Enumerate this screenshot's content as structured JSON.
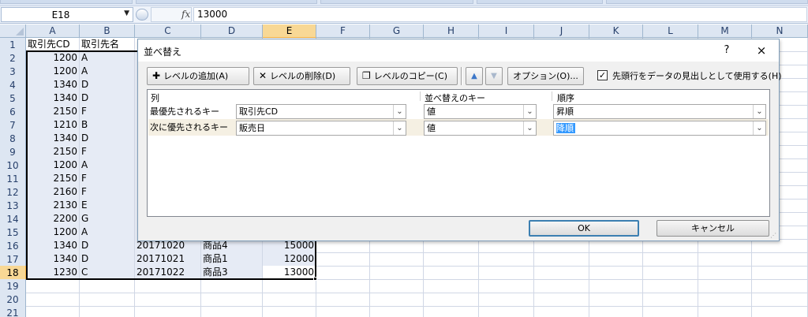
{
  "name_box": "E18",
  "fx_label": "fx",
  "formula_value": "13000",
  "columns": [
    "A",
    "B",
    "C",
    "D",
    "E",
    "F",
    "G",
    "H",
    "I",
    "J",
    "K",
    "L",
    "M",
    "N"
  ],
  "rows": [
    "1",
    "2",
    "3",
    "4",
    "5",
    "6",
    "7",
    "8",
    "9",
    "10",
    "11",
    "12",
    "13",
    "14",
    "15",
    "16",
    "17",
    "18",
    "19",
    "20",
    "21"
  ],
  "sheet": {
    "headers": {
      "A": "取引先CD",
      "B": "取引先名"
    },
    "col_a": [
      "1200",
      "1200",
      "1340",
      "1340",
      "2150",
      "1210",
      "1340",
      "2150",
      "1200",
      "2150",
      "2160",
      "2130",
      "2200",
      "1200",
      "1340",
      "1340",
      "1230"
    ],
    "col_b": [
      "A",
      "A",
      "D",
      "D",
      "F",
      "B",
      "D",
      "F",
      "A",
      "F",
      "F",
      "E",
      "G",
      "A",
      "D",
      "D",
      "C"
    ],
    "lower_rows": [
      {
        "c": "20171020",
        "d": "商品4",
        "e": "15000"
      },
      {
        "c": "20171021",
        "d": "商品1",
        "e": "12000"
      },
      {
        "c": "20171022",
        "d": "商品3",
        "e": "13000"
      }
    ]
  },
  "dialog": {
    "title": "並べ替え",
    "help": "?",
    "close": "×",
    "toolbar": {
      "add_level": "レベルの追加(A)",
      "delete_level": "レベルの削除(D)",
      "copy_level": "レベルのコピー(C)",
      "options": "オプション(O)...",
      "has_header_label": "先頭行をデータの見出しとして使用する(H)",
      "has_header_checked": true
    },
    "list_headers": {
      "column": "列",
      "sort_on": "並べ替えのキー",
      "order": "順序"
    },
    "levels": [
      {
        "label": "最優先されるキー",
        "column": "取引先CD",
        "sort_on": "値",
        "order": "昇順",
        "selected": false
      },
      {
        "label": "次に優先されるキー",
        "column": "販売日",
        "sort_on": "値",
        "order": "降順",
        "selected": true
      }
    ],
    "ok": "OK",
    "cancel": "キャンセル"
  }
}
